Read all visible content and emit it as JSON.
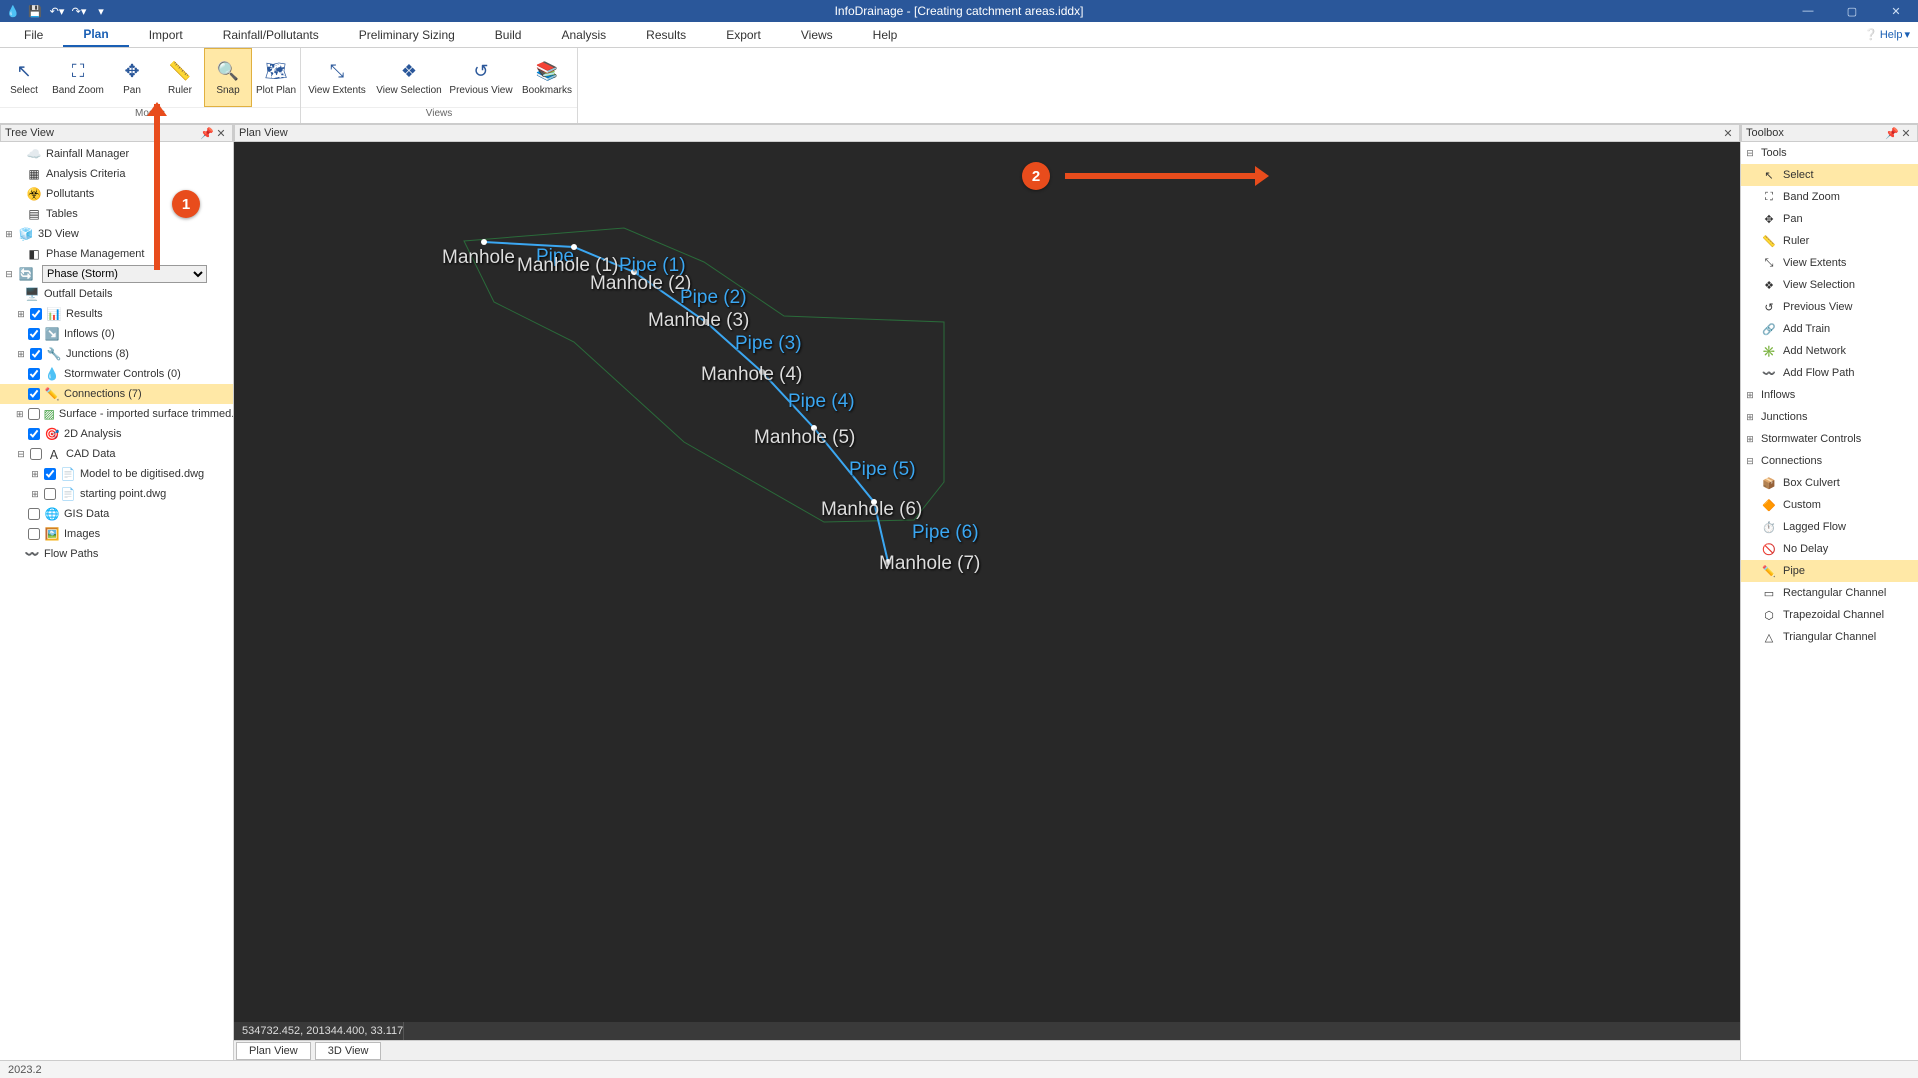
{
  "title": "InfoDrainage - [Creating catchment areas.iddx]",
  "menu": {
    "file": "File",
    "plan": "Plan",
    "import": "Import",
    "rainfall": "Rainfall/Pollutants",
    "prelim": "Preliminary Sizing",
    "build": "Build",
    "analysis": "Analysis",
    "results": "Results",
    "export": "Export",
    "views": "Views",
    "help": "Help",
    "help_corner": "Help"
  },
  "ribbon": {
    "modes_label": "Modes",
    "views_label": "Views",
    "select": "Select",
    "band_zoom": "Band Zoom",
    "pan": "Pan",
    "ruler": "Ruler",
    "snap": "Snap",
    "plot_plan": "Plot Plan",
    "view_extents": "View Extents",
    "view_selection": "View Selection",
    "previous_view": "Previous View",
    "bookmarks": "Bookmarks"
  },
  "panels": {
    "tree": "Tree View",
    "plan": "Plan View",
    "toolbox": "Toolbox"
  },
  "tree": {
    "rainfall_mgr": "Rainfall Manager",
    "analysis_crit": "Analysis Criteria",
    "pollutants": "Pollutants",
    "tables": "Tables",
    "view3d": "3D View",
    "phase_mgmt": "Phase Management",
    "phase_value": "Phase (Storm)",
    "outfall": "Outfall Details",
    "results": "Results",
    "inflows": "Inflows (0)",
    "junctions": "Junctions (8)",
    "storm_ctrl": "Stormwater Controls (0)",
    "connections": "Connections (7)",
    "surface": "Surface - imported surface trimmed.idsx",
    "analysis2d": "2D Analysis",
    "cad_data": "CAD Data",
    "model_dwg": "Model to be digitised.dwg",
    "starting_pt": "starting point.dwg",
    "gis_data": "GIS Data",
    "images": "Images",
    "flow_paths": "Flow Paths"
  },
  "plan_labels": {
    "mh1": "Manhole (1)",
    "mh2": "Manhole (2)",
    "mh3": "Manhole (3)",
    "mh4": "Manhole (4)",
    "mh5": "Manhole (5)",
    "mh6": "Manhole (6)",
    "mh7": "Manhole (7)",
    "manhole_top": "Manhole",
    "pipe_top": "Pipe",
    "p1": "Pipe (1)",
    "p2": "Pipe (2)",
    "p3": "Pipe (3)",
    "p4": "Pipe (4)",
    "p5": "Pipe (5)",
    "p6": "Pipe (6)"
  },
  "status": {
    "coords": "534732.452, 201344.400, 33.117"
  },
  "view_tabs": {
    "plan": "Plan View",
    "view3d": "3D View"
  },
  "toolbox": {
    "tools": "Tools",
    "select": "Select",
    "band_zoom": "Band Zoom",
    "pan": "Pan",
    "ruler": "Ruler",
    "view_extents": "View Extents",
    "view_selection": "View Selection",
    "previous_view": "Previous View",
    "add_train": "Add Train",
    "add_network": "Add Network",
    "add_flow_path": "Add Flow Path",
    "inflows": "Inflows",
    "junctions": "Junctions",
    "storm_ctrl": "Stormwater Controls",
    "connections": "Connections",
    "box_culvert": "Box Culvert",
    "custom": "Custom",
    "lagged_flow": "Lagged Flow",
    "no_delay": "No Delay",
    "pipe": "Pipe",
    "rect_channel": "Rectangular Channel",
    "trap_channel": "Trapezoidal Channel",
    "tri_channel": "Triangular Channel"
  },
  "callouts": {
    "one": "1",
    "two": "2"
  },
  "footer": {
    "version": "2023.2"
  }
}
